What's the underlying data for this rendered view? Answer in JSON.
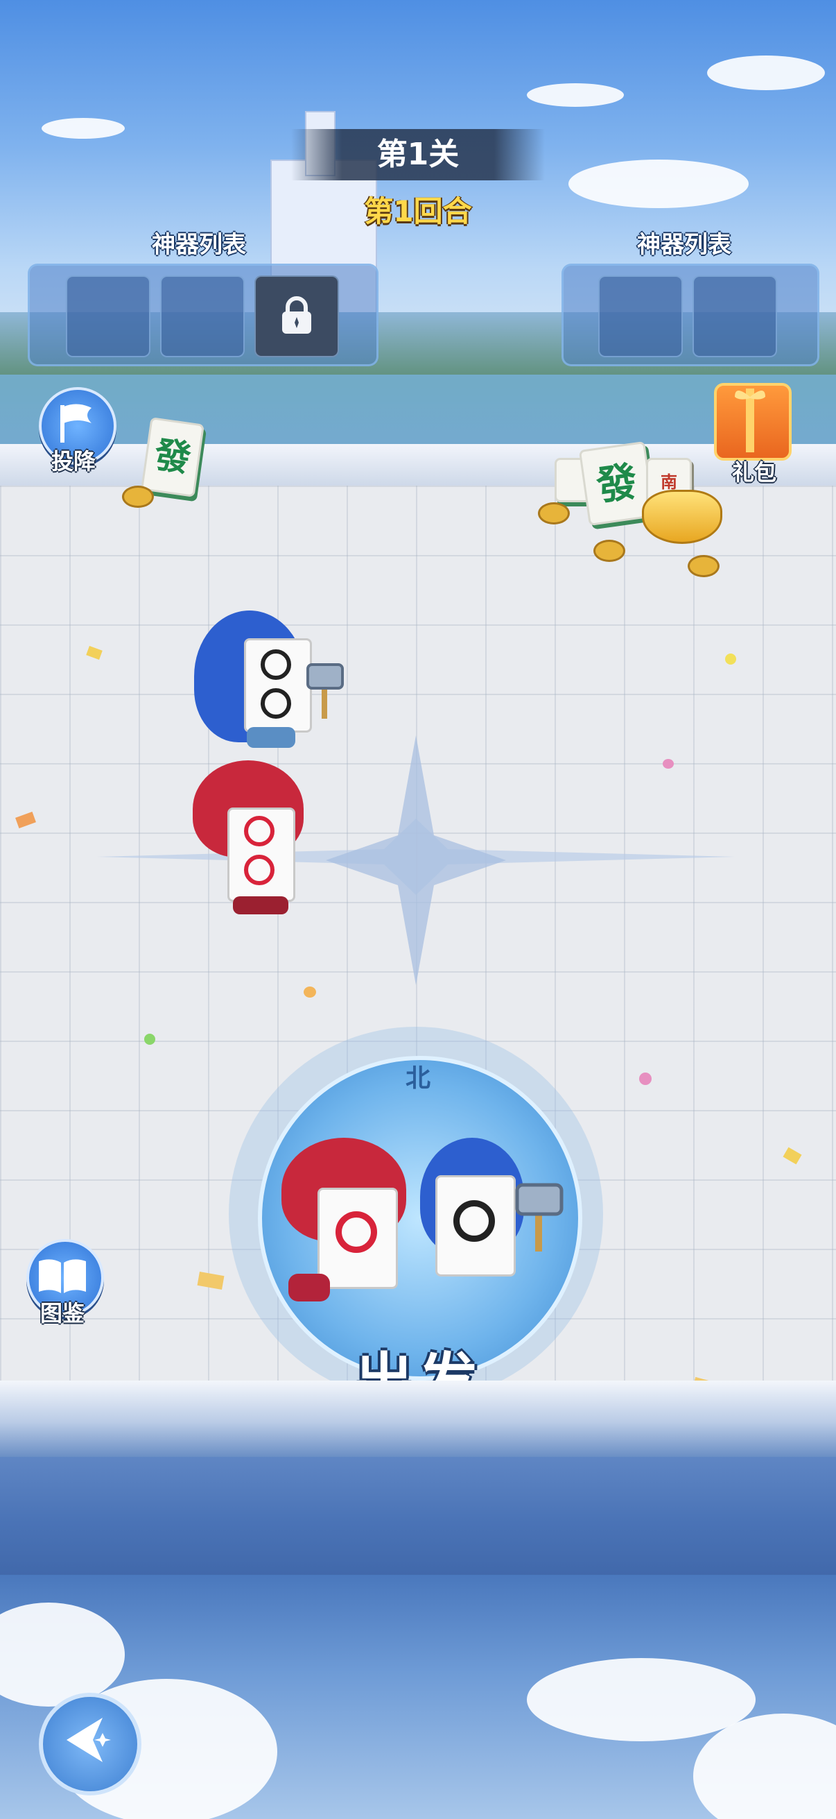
{
  "stage": {
    "title": "第1关",
    "round": "第1回合"
  },
  "artifacts": {
    "left_label": "神器列表",
    "right_label": "神器列表"
  },
  "buttons": {
    "surrender": "投降",
    "gift": "礼包",
    "codex": "图鉴",
    "go": "出发"
  },
  "tiles": {
    "fa": "發",
    "nan": "南"
  },
  "compass": {
    "north": "北"
  },
  "colors": {
    "accent_gold": "#ffd84a",
    "button_blue": "#2f73d6",
    "tile_green": "#1f8a4a",
    "target_red": "#d8233a"
  }
}
